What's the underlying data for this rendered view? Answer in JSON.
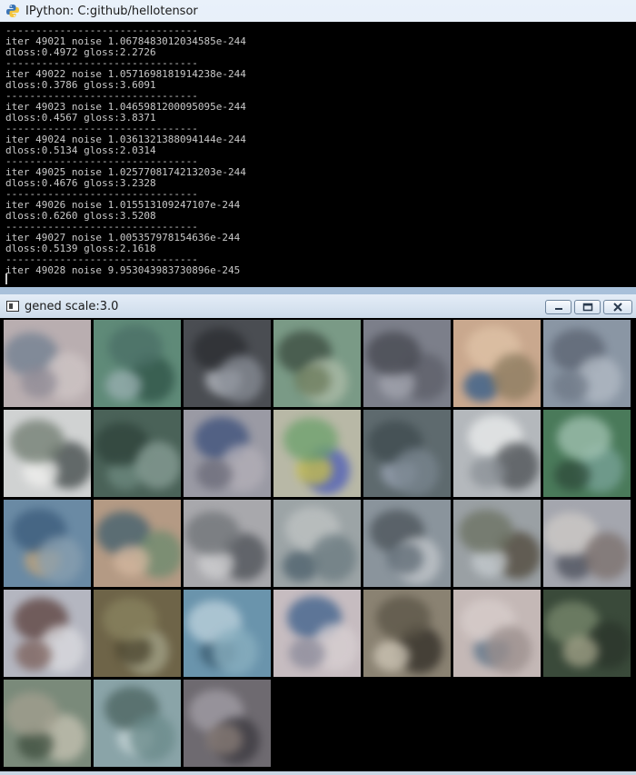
{
  "console": {
    "title": "IPython: C:github/hellotensor",
    "lines": [
      "--------------------------------",
      "iter 49021 noise 1.0678483012034585e-244",
      "dloss:0.4972 gloss:2.2726",
      "--------------------------------",
      "iter 49022 noise 1.0571698181914238e-244",
      "dloss:0.3786 gloss:3.6091",
      "--------------------------------",
      "iter 49023 noise 1.0465981200095095e-244",
      "dloss:0.4567 gloss:3.8371",
      "--------------------------------",
      "iter 49024 noise 1.0361321388094144e-244",
      "dloss:0.5134 gloss:2.0314",
      "--------------------------------",
      "iter 49025 noise 1.0257708174213203e-244",
      "dloss:0.4676 gloss:3.2328",
      "--------------------------------",
      "iter 49026 noise 1.015513109247107e-244",
      "dloss:0.6260 gloss:3.5208",
      "--------------------------------",
      "iter 49027 noise 1.005357978154636e-244",
      "dloss:0.5139 gloss:2.1618",
      "--------------------------------",
      "iter 49028 noise 9.953043983730896e-245"
    ],
    "icon": "python-icon"
  },
  "gened_window": {
    "title": "gened scale:3.0",
    "icon": "window-icon",
    "controls": {
      "minimize": "minimize-icon",
      "maximize": "maximize-icon",
      "close": "close-icon"
    },
    "grid_columns": 7,
    "tiles": [
      {
        "bg": "#b9aeb0",
        "blobs": [
          "#6f7e90",
          "#cfc6c6",
          "#8e8a95"
        ]
      },
      {
        "bg": "#5f8a78",
        "blobs": [
          "#2e5246",
          "#9ab0b2",
          "#4a6e66"
        ]
      },
      {
        "bg": "#4a4d52",
        "blobs": [
          "#b8bcc4",
          "#2a2c30",
          "#8a8f98"
        ]
      },
      {
        "bg": "#7a9a86",
        "blobs": [
          "#3a4a3e",
          "#aebca8",
          "#6b7a5a"
        ]
      },
      {
        "bg": "#7c7f8a",
        "blobs": [
          "#5c5e68",
          "#a4a6b0",
          "#45474f"
        ]
      },
      {
        "bg": "#c9a88e",
        "blobs": [
          "#2e5a8a",
          "#e0c4a8",
          "#8a7a5e"
        ]
      },
      {
        "bg": "#8a96a4",
        "blobs": [
          "#5a6270",
          "#b4bcc6",
          "#6e7886"
        ]
      },
      {
        "bg": "#d0d2d2",
        "blobs": [
          "#3e4646",
          "#f0f0ee",
          "#6e7a6e"
        ]
      },
      {
        "bg": "#4a6258",
        "blobs": [
          "#6e8a80",
          "#2e423a",
          "#8aa098"
        ]
      },
      {
        "bg": "#9a9aa4",
        "blobs": [
          "#3a4e7a",
          "#b4b0b8",
          "#6a6a78"
        ]
      },
      {
        "bg": "#b8b8a6",
        "blobs": [
          "#4a5ab8",
          "#c8c04a",
          "#6aa06a"
        ]
      },
      {
        "bg": "#5e6a6e",
        "blobs": [
          "#9aa4b4",
          "#3e4a4e",
          "#7a8690"
        ]
      },
      {
        "bg": "#b4b8bc",
        "blobs": [
          "#eceeee",
          "#4a4e52",
          "#8a9096"
        ]
      },
      {
        "bg": "#4a7a5a",
        "blobs": [
          "#7aa49a",
          "#2e4a3a",
          "#a4c4b4"
        ]
      },
      {
        "bg": "#6a8aa4",
        "blobs": [
          "#c4a478",
          "#3a5a7a",
          "#8aa0b0"
        ]
      },
      {
        "bg": "#b49a84",
        "blobs": [
          "#3e5e6e",
          "#6a8a6e",
          "#d4b8a0"
        ]
      },
      {
        "bg": "#a8a8ac",
        "blobs": [
          "#4a4e54",
          "#d0d0d2",
          "#6e7276"
        ]
      },
      {
        "bg": "#9ca4a6",
        "blobs": [
          "#4a5e6a",
          "#c0c4c4",
          "#6a7a80"
        ]
      },
      {
        "bg": "#8a949c",
        "blobs": [
          "#4a5258",
          "#c4c8cc",
          "#5e6a74"
        ]
      },
      {
        "bg": "#9aa0a4",
        "blobs": [
          "#4e4638",
          "#c6ccd0",
          "#6a7060"
        ]
      },
      {
        "bg": "#a4a6ae",
        "blobs": [
          "#4a4e5a",
          "#d0ccc8",
          "#7a6e6a"
        ]
      },
      {
        "bg": "#b4b6c0",
        "blobs": [
          "#5a3e3a",
          "#dcdce0",
          "#7a5e58"
        ]
      },
      {
        "bg": "#6e6448",
        "blobs": [
          "#a4a48a",
          "#4a442e",
          "#8a8460"
        ]
      },
      {
        "bg": "#6a94ac",
        "blobs": [
          "#3a5a6e",
          "#c0d4de",
          "#8ab0c0"
        ]
      },
      {
        "bg": "#c6bcc0",
        "blobs": [
          "#3a5e8a",
          "#d8d0d2",
          "#8a8a9a"
        ]
      },
      {
        "bg": "#8a8272",
        "blobs": [
          "#2e2a24",
          "#d0c8b8",
          "#5a5446"
        ]
      },
      {
        "bg": "#c4b8b6",
        "blobs": [
          "#5a7288",
          "#d8cecc",
          "#9a8e8c"
        ]
      },
      {
        "bg": "#3a4a3a",
        "blobs": [
          "#7a8a6e",
          "#2a342a",
          "#a4a48a"
        ]
      },
      {
        "bg": "#7a8a7a",
        "blobs": [
          "#c8c4b4",
          "#3e4e3e",
          "#a4a090"
        ]
      },
      {
        "bg": "#8aa4a8",
        "blobs": [
          "#c8d6d8",
          "#4a625e",
          "#6a8a8a"
        ]
      },
      {
        "bg": "#6e6a70",
        "blobs": [
          "#a4a0a8",
          "#3a383e",
          "#8a7e78"
        ]
      }
    ]
  }
}
